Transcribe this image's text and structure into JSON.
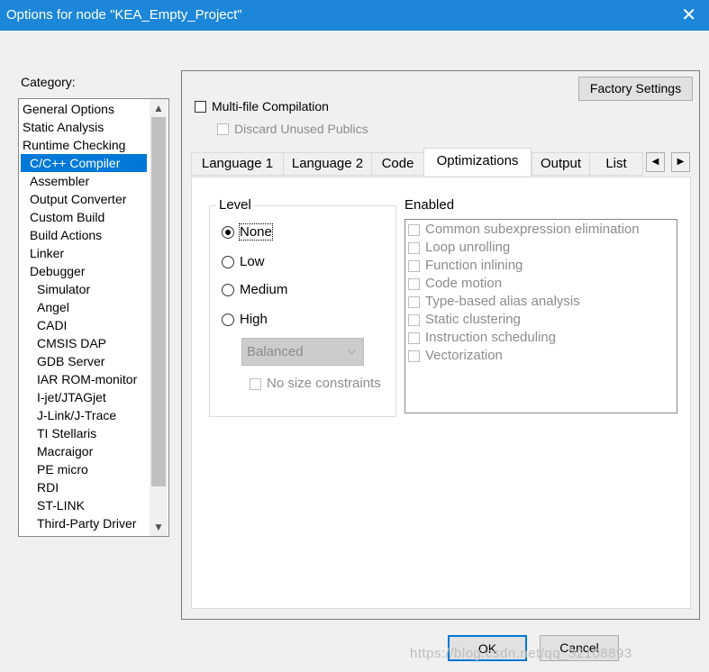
{
  "window": {
    "title": "Options for node \"KEA_Empty_Project\"",
    "close_glyph": "✕"
  },
  "category": {
    "label": "Category:",
    "selected": "C/C++ Compiler",
    "items": [
      "General Options",
      "Static Analysis",
      "Runtime Checking",
      "C/C++ Compiler",
      "Assembler",
      "Output Converter",
      "Custom Build",
      "Build Actions",
      "Linker",
      "Debugger",
      "Simulator",
      "Angel",
      "CADI",
      "CMSIS DAP",
      "GDB Server",
      "IAR ROM-monitor",
      "I-jet/JTAGjet",
      "J-Link/J-Trace",
      "TI Stellaris",
      "Macraigor",
      "PE micro",
      "RDI",
      "ST-LINK",
      "Third-Party Driver"
    ]
  },
  "factory_settings": "Factory Settings",
  "multifile": {
    "label": "Multi-file Compilation",
    "checked": false
  },
  "discard": {
    "label": "Discard Unused Publics",
    "checked": false,
    "enabled": false
  },
  "tabs": [
    "Language 1",
    "Language 2",
    "Code",
    "Optimizations",
    "Output",
    "List"
  ],
  "active_tab": "Optimizations",
  "tab_scroll": {
    "left": "◀",
    "right": "▶"
  },
  "level": {
    "title": "Level",
    "options": [
      "None",
      "Low",
      "Medium",
      "High"
    ],
    "selected": "None",
    "high_mode": "Balanced",
    "no_size_constraints": "No size constraints"
  },
  "enabled": {
    "title": "Enabled",
    "options": [
      "Common subexpression elimination",
      "Loop unrolling",
      "Function inlining",
      "Code motion",
      "Type-based alias analysis",
      "Static clustering",
      "Instruction scheduling",
      "Vectorization"
    ]
  },
  "buttons": {
    "ok": "OK",
    "cancel": "Cancel"
  },
  "watermark": "https://blog.csdn.net/qq_32108893"
}
